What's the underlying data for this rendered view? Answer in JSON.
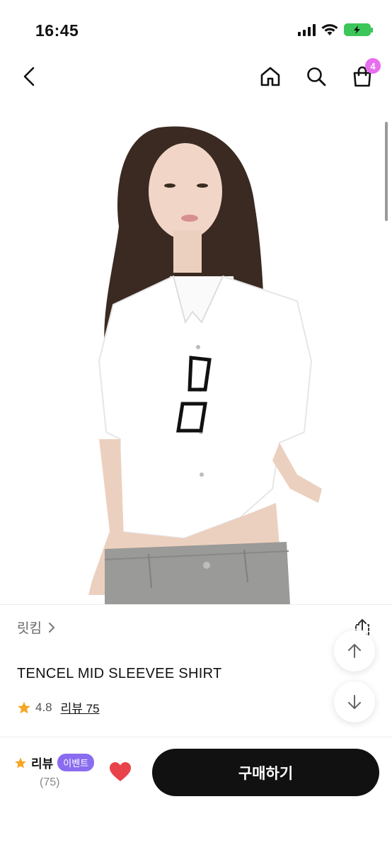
{
  "status_bar": {
    "time": "16:45"
  },
  "nav": {
    "cart_count": "4"
  },
  "product": {
    "brand": "릿킴",
    "title": "TENCEL MID SLEEVEE SHIRT",
    "rating": "4.8",
    "review_link": "리뷰 75"
  },
  "bottom_bar": {
    "review_label": "리뷰",
    "event_badge": "이벤트",
    "review_count": "(75)",
    "buy_label": "구매하기"
  },
  "colors": {
    "accent_star": "#f5a623",
    "heart": "#e8434a",
    "badge_cart": "#e86ef0",
    "badge_event": "#8a6cf0",
    "buy_button": "#111111"
  },
  "icons": [
    "back-icon",
    "home-icon",
    "search-icon",
    "cart-icon",
    "share-icon",
    "arrow-up-icon",
    "arrow-down-icon",
    "star-icon",
    "heart-icon"
  ]
}
